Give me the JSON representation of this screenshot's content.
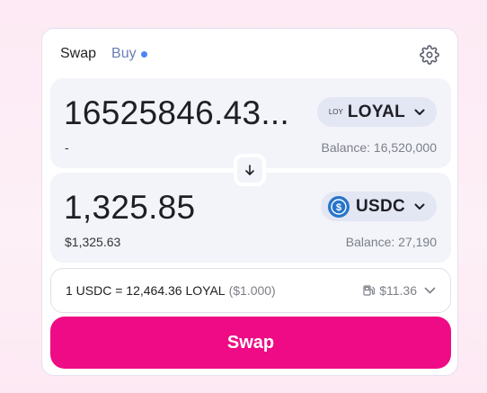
{
  "tabs": {
    "swap": "Swap",
    "buy": "Buy"
  },
  "input": {
    "amount": "16525846.43...",
    "fiat": "-",
    "token_logo": "LOY",
    "token": "LOYAL",
    "balance": "Balance: 16,520,000"
  },
  "output": {
    "amount": "1,325.85",
    "fiat": "$1,325.63",
    "token": "USDC",
    "balance": "Balance: 27,190"
  },
  "rate": {
    "text": "1 USDC = 12,464.36 LOYAL",
    "usd": "($1.000)",
    "gas": "$11.36"
  },
  "swap_button": "Swap",
  "colors": {
    "accent": "#ef0b85",
    "usdc": "#2775ca",
    "buy_dot": "#4c82fb"
  },
  "icons": [
    "gear-icon",
    "arrow-down-icon",
    "chevron-down-icon",
    "usdc-logo-icon",
    "gas-pump-icon"
  ]
}
